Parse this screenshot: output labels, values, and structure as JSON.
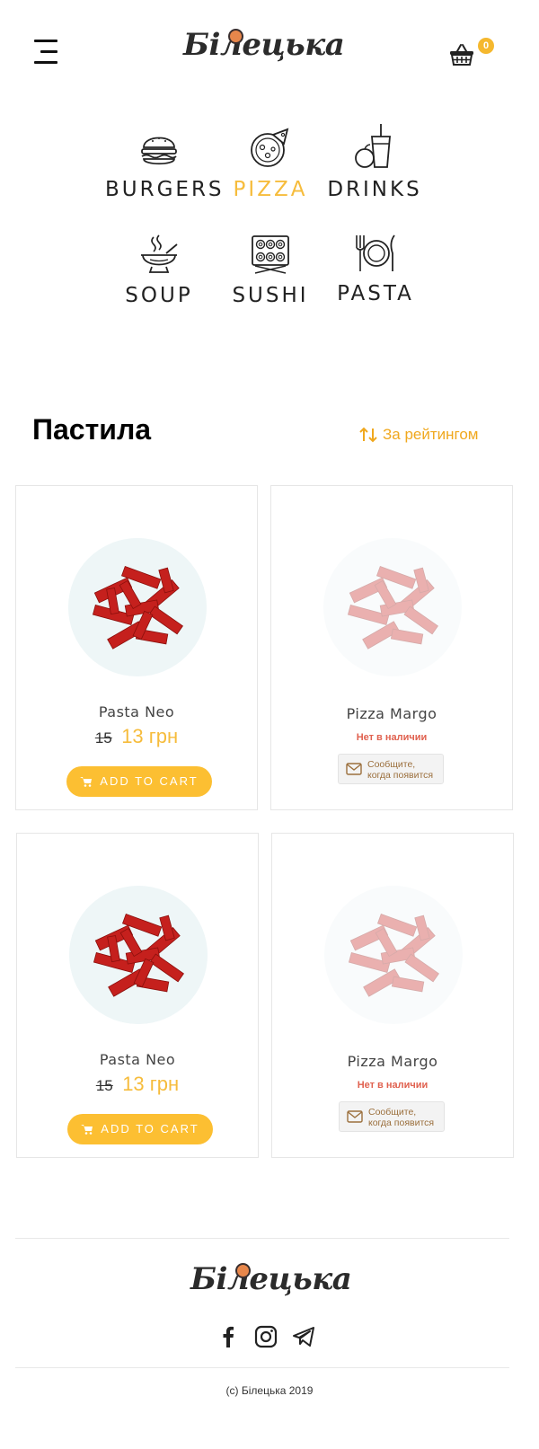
{
  "header": {
    "brand": "Білецька",
    "cart_count": "0"
  },
  "categories": [
    {
      "label": "BURGERS",
      "icon": "burger-icon",
      "active": false
    },
    {
      "label": "PIZZA",
      "icon": "pizza-icon",
      "active": true
    },
    {
      "label": "DRINKS",
      "icon": "drink-icon",
      "active": false
    },
    {
      "label": "SOUP",
      "icon": "soup-icon",
      "active": false
    },
    {
      "label": "SUSHI",
      "icon": "sushi-icon",
      "active": false
    },
    {
      "label": "PASTA",
      "icon": "plate-icon",
      "active": false
    }
  ],
  "listing": {
    "title": "Пастила",
    "sort_label": "За рейтингом"
  },
  "products": [
    {
      "name": "Pasta Neo",
      "old_price": "15",
      "price": "13 грн",
      "button": "ADD TO CART",
      "available": true
    },
    {
      "name": "Pizza Margo",
      "status": "Нет в наличии",
      "notify_line1": "Сообщите,",
      "notify_line2": "когда появится",
      "available": false
    },
    {
      "name": "Pasta Neo",
      "old_price": "15",
      "price": "13 грн",
      "button": "ADD TO CART",
      "available": true
    },
    {
      "name": "Pizza Margo",
      "status": "Нет в наличии",
      "notify_line1": "Сообщите,",
      "notify_line2": "когда появится",
      "available": false
    }
  ],
  "footer": {
    "brand": "Білецька",
    "social": [
      "facebook-icon",
      "instagram-icon",
      "telegram-icon"
    ],
    "copyright": "(c) Білецька 2019"
  },
  "colors": {
    "accent": "#f6bc3c",
    "button": "#fcbf32",
    "unavailable": "#e0614f"
  }
}
